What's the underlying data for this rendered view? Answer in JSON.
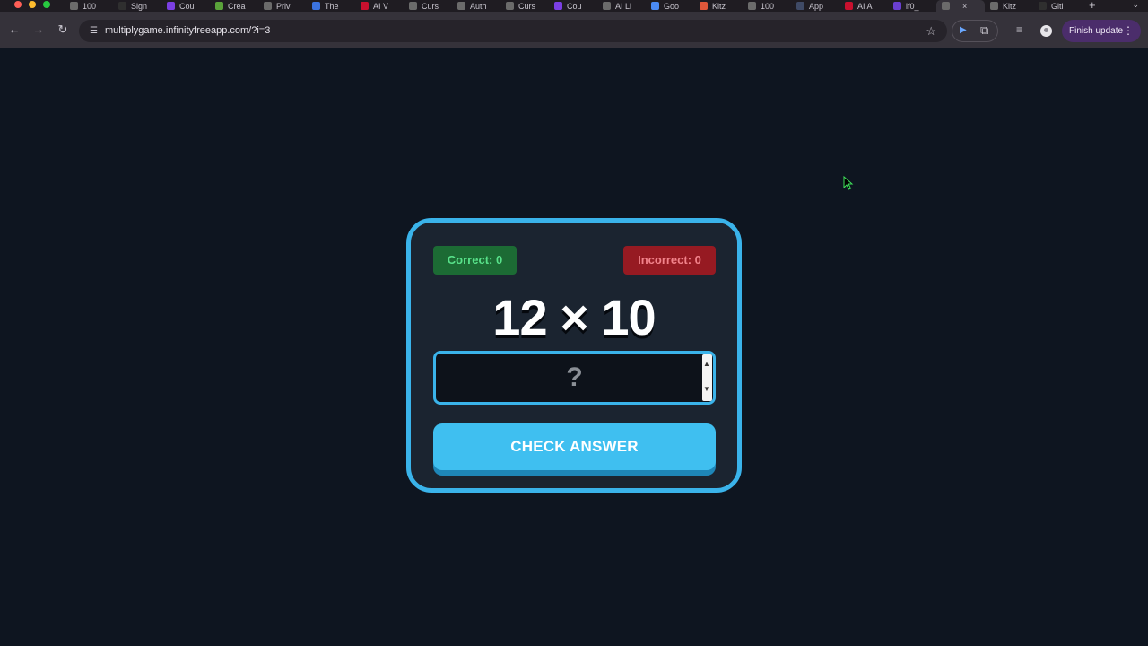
{
  "browser": {
    "tabs": [
      {
        "label": "100",
        "icon": "gpt-icon",
        "color": "#6b6b6b"
      },
      {
        "label": "Sign",
        "icon": "link-icon",
        "color": "#2f2f2f"
      },
      {
        "label": "Cou",
        "icon": "u-icon",
        "color": "#7b3fe4"
      },
      {
        "label": "Crea",
        "icon": "shopify-icon",
        "color": "#5aa23a"
      },
      {
        "label": "Priv",
        "icon": "hat-icon",
        "color": "#6b6b6b"
      },
      {
        "label": "The",
        "icon": "doc-icon",
        "color": "#3b73e0"
      },
      {
        "label": "AI V",
        "icon": "sk-icon",
        "color": "#c8102e"
      },
      {
        "label": "Curs",
        "icon": "cube-icon",
        "color": "#6b6b6b"
      },
      {
        "label": "Auth",
        "icon": "cube-icon",
        "color": "#6b6b6b"
      },
      {
        "label": "Curs",
        "icon": "cube-icon",
        "color": "#6b6b6b"
      },
      {
        "label": "Cou",
        "icon": "u-icon",
        "color": "#7b3fe4"
      },
      {
        "label": "AI Li",
        "icon": "gpt-icon",
        "color": "#6b6b6b"
      },
      {
        "label": "Goo",
        "icon": "gemini-icon",
        "color": "#4a8af4"
      },
      {
        "label": "Kitz",
        "icon": "burst-icon",
        "color": "#e0573a"
      },
      {
        "label": "100",
        "icon": "gpt-icon",
        "color": "#6b6b6b"
      },
      {
        "label": "App",
        "icon": "file-icon",
        "color": "#3f4a66"
      },
      {
        "label": "AI A",
        "icon": "sk-icon",
        "color": "#c8102e"
      },
      {
        "label": "if0_",
        "icon": "infinity-icon",
        "color": "#6a3fd0"
      },
      {
        "label": "",
        "icon": "globe-icon",
        "color": "#6b6b6b",
        "active": true
      },
      {
        "label": "Kitz",
        "icon": "globe-icon",
        "color": "#6b6b6b"
      },
      {
        "label": "Gitl",
        "icon": "github-icon",
        "color": "#2f2f2f"
      }
    ],
    "url": "multiplygame.infinityfreeapp.com/?i=3",
    "finish_update": "Finish update"
  },
  "game": {
    "correct_label": "Correct: 0",
    "incorrect_label": "Incorrect: 0",
    "problem": "12 × 10",
    "answer_placeholder": "?",
    "answer_value": "",
    "check_button": "CHECK ANSWER"
  },
  "colors": {
    "page_bg": "#0e1520",
    "card_bg": "#1b2430",
    "accent": "#3ab3ea",
    "correct_bg": "#1c6b34",
    "correct_fg": "#58e28a",
    "incorrect_bg": "#961a22",
    "incorrect_fg": "#f2838b"
  }
}
